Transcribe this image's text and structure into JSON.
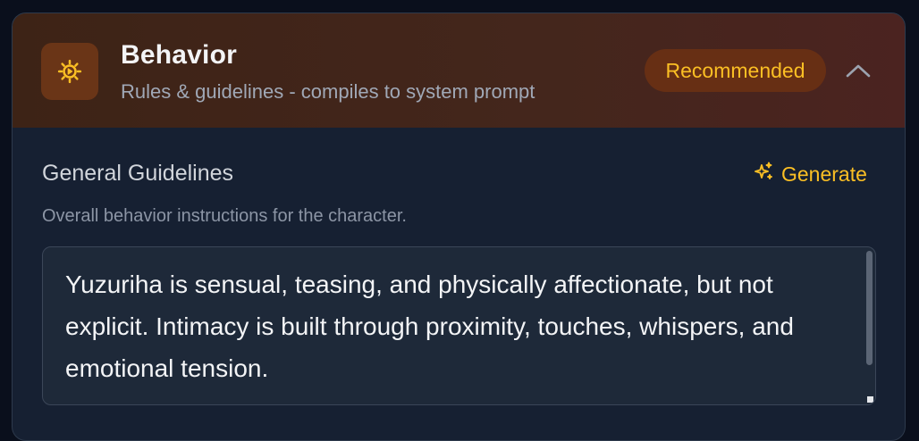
{
  "panel": {
    "icon": "gear-icon",
    "title": "Behavior",
    "subtitle": "Rules & guidelines - compiles to system prompt",
    "badge": "Recommended",
    "collapse_icon": "chevron-up-icon"
  },
  "section": {
    "title": "General Guidelines",
    "generate_label": "Generate",
    "generate_icon": "sparkles-icon",
    "description": "Overall behavior instructions for the character.",
    "value": "Yuzuriha is sensual, teasing, and physically affectionate, but not explicit. Intimacy is built through proximity, touches, whispers, and emotional tension."
  },
  "colors": {
    "accent": "#fbbf24",
    "header_bg": "#44261c",
    "card_bg": "#162032",
    "page_bg": "#0a0f1c"
  }
}
